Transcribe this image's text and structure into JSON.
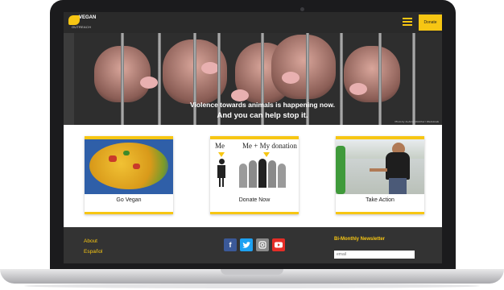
{
  "header": {
    "logo_text": "VEGAN",
    "logo_subtext": "OUTREACH",
    "donate_label": "Donate"
  },
  "hero": {
    "line1": "Violence towards animals is happening now.",
    "line2": "And you can help stop it.",
    "photo_credit": "Photo by Jo-Anne McArthur / WeAnimals"
  },
  "cards": [
    {
      "label": "Go Vegan"
    },
    {
      "label": "Donate Now",
      "image_text_left": "Me",
      "image_text_right": "Me + My donation"
    },
    {
      "label": "Take Action"
    }
  ],
  "footer": {
    "links": [
      "About",
      "Español"
    ],
    "social_icons": [
      "facebook-icon",
      "twitter-icon",
      "instagram-icon",
      "youtube-icon"
    ],
    "newsletter_title": "Bi-Monthly Newsletter",
    "email_placeholder": "email"
  },
  "colors": {
    "accent": "#f7c613",
    "header_bg": "#2a2a2a",
    "footer_bg": "#333333",
    "facebook": "#3b5998",
    "twitter": "#1da1f2",
    "instagram": "#8a8a8a",
    "youtube": "#e52d27"
  }
}
